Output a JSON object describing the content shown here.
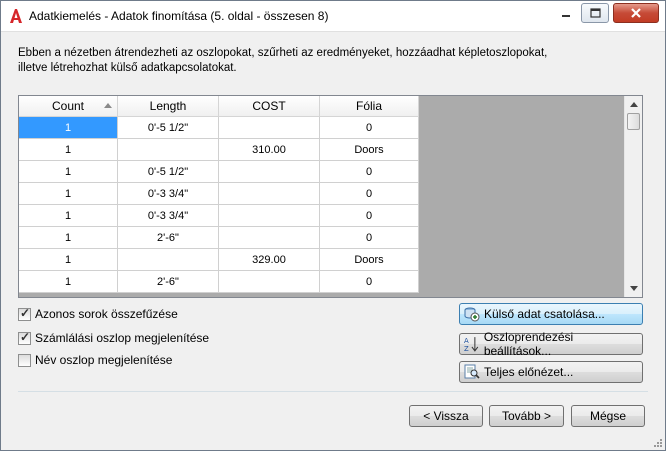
{
  "window": {
    "title": "Adatkiemelés - Adatok finomítása (5. oldal - összesen 8)"
  },
  "description": {
    "line1": "Ebben a nézetben átrendezheti az oszlopokat, szűrheti az eredményeket, hozzáadhat képletoszlopokat,",
    "line2": "illetve létrehozhat külső adatkapcsolatokat."
  },
  "grid": {
    "columns": [
      "Count",
      "Length",
      "COST",
      "Fólia"
    ],
    "rows": [
      [
        "1",
        "0'-5 1/2\"",
        "",
        "0"
      ],
      [
        "1",
        "",
        "310.00",
        "Doors"
      ],
      [
        "1",
        "0'-5 1/2\"",
        "",
        "0"
      ],
      [
        "1",
        "0'-3 3/4\"",
        "",
        "0"
      ],
      [
        "1",
        "0'-3 3/4\"",
        "",
        "0"
      ],
      [
        "1",
        "2'-6\"",
        "",
        "0"
      ],
      [
        "1",
        "",
        "329.00",
        "Doors"
      ],
      [
        "1",
        "2'-6\"",
        "",
        "0"
      ]
    ]
  },
  "options": {
    "combine_rows": {
      "label": "Azonos sorok összefűzése",
      "checked": true
    },
    "show_count": {
      "label": "Számlálási oszlop megjelenítése",
      "checked": true
    },
    "show_name": {
      "label": "Név oszlop megjelenítése",
      "checked": false
    }
  },
  "actions": {
    "link_external": "Külső adat csatolása...",
    "sort_settings": "Oszloprendezési beállítások...",
    "full_preview": "Teljes előnézet..."
  },
  "footer": {
    "back": "< Vissza",
    "next": "Tovább >",
    "cancel": "Mégse"
  },
  "colors": {
    "selection": "#3399ff",
    "grid_empty_area": "#ababab",
    "app_icon_red": "#d6262a"
  }
}
